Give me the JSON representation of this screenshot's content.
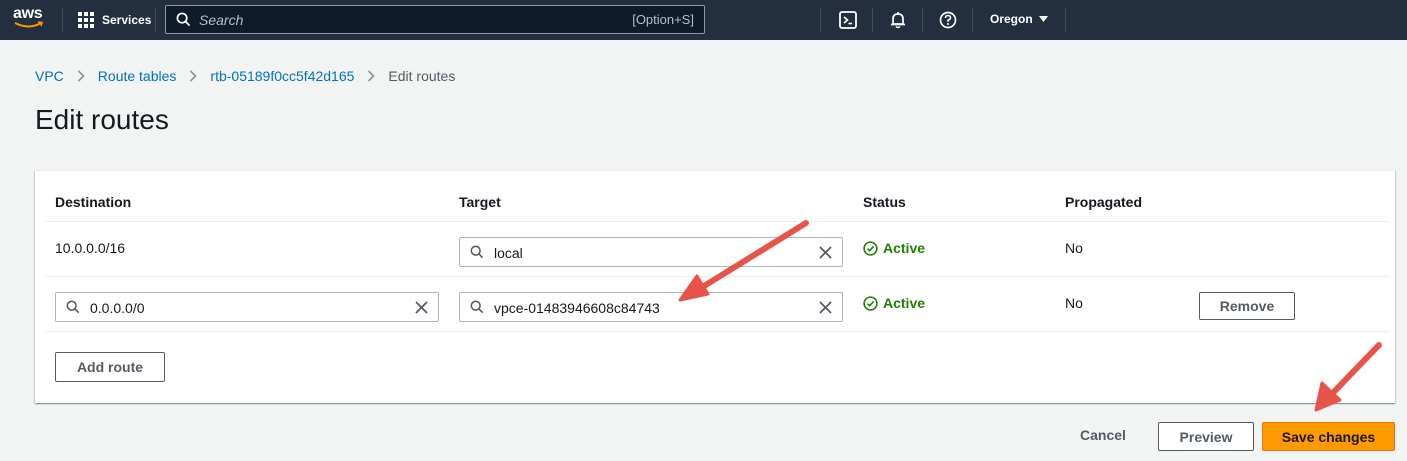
{
  "nav": {
    "logo_text": "aws",
    "services_label": "Services",
    "search_placeholder": "Search",
    "search_shortcut": "[Option+S]",
    "region_label": "Oregon",
    "icons": [
      "cloudshell-icon",
      "bell-icon",
      "help-icon"
    ]
  },
  "breadcrumb": {
    "items": [
      "VPC",
      "Route tables",
      "rtb-05189f0cc5f42d165"
    ],
    "current": "Edit routes"
  },
  "page": {
    "title": "Edit routes"
  },
  "table": {
    "headers": {
      "destination": "Destination",
      "target": "Target",
      "status": "Status",
      "propagated": "Propagated"
    },
    "rows": [
      {
        "destination": "10.0.0.0/16",
        "target": "local",
        "status": "Active",
        "propagated": "No"
      },
      {
        "destination": "0.0.0.0/0",
        "target": "vpce-01483946608c84743",
        "status": "Active",
        "propagated": "No",
        "remove_label": "Remove"
      }
    ],
    "add_route_label": "Add route"
  },
  "footer": {
    "cancel_label": "Cancel",
    "preview_label": "Preview",
    "save_label": "Save changes"
  },
  "colors": {
    "nav_bg": "#232f3e",
    "link": "#0073bb",
    "status_active": "#1d8102",
    "primary_button": "#ff9900",
    "annotation_arrow": "#e8534a"
  }
}
